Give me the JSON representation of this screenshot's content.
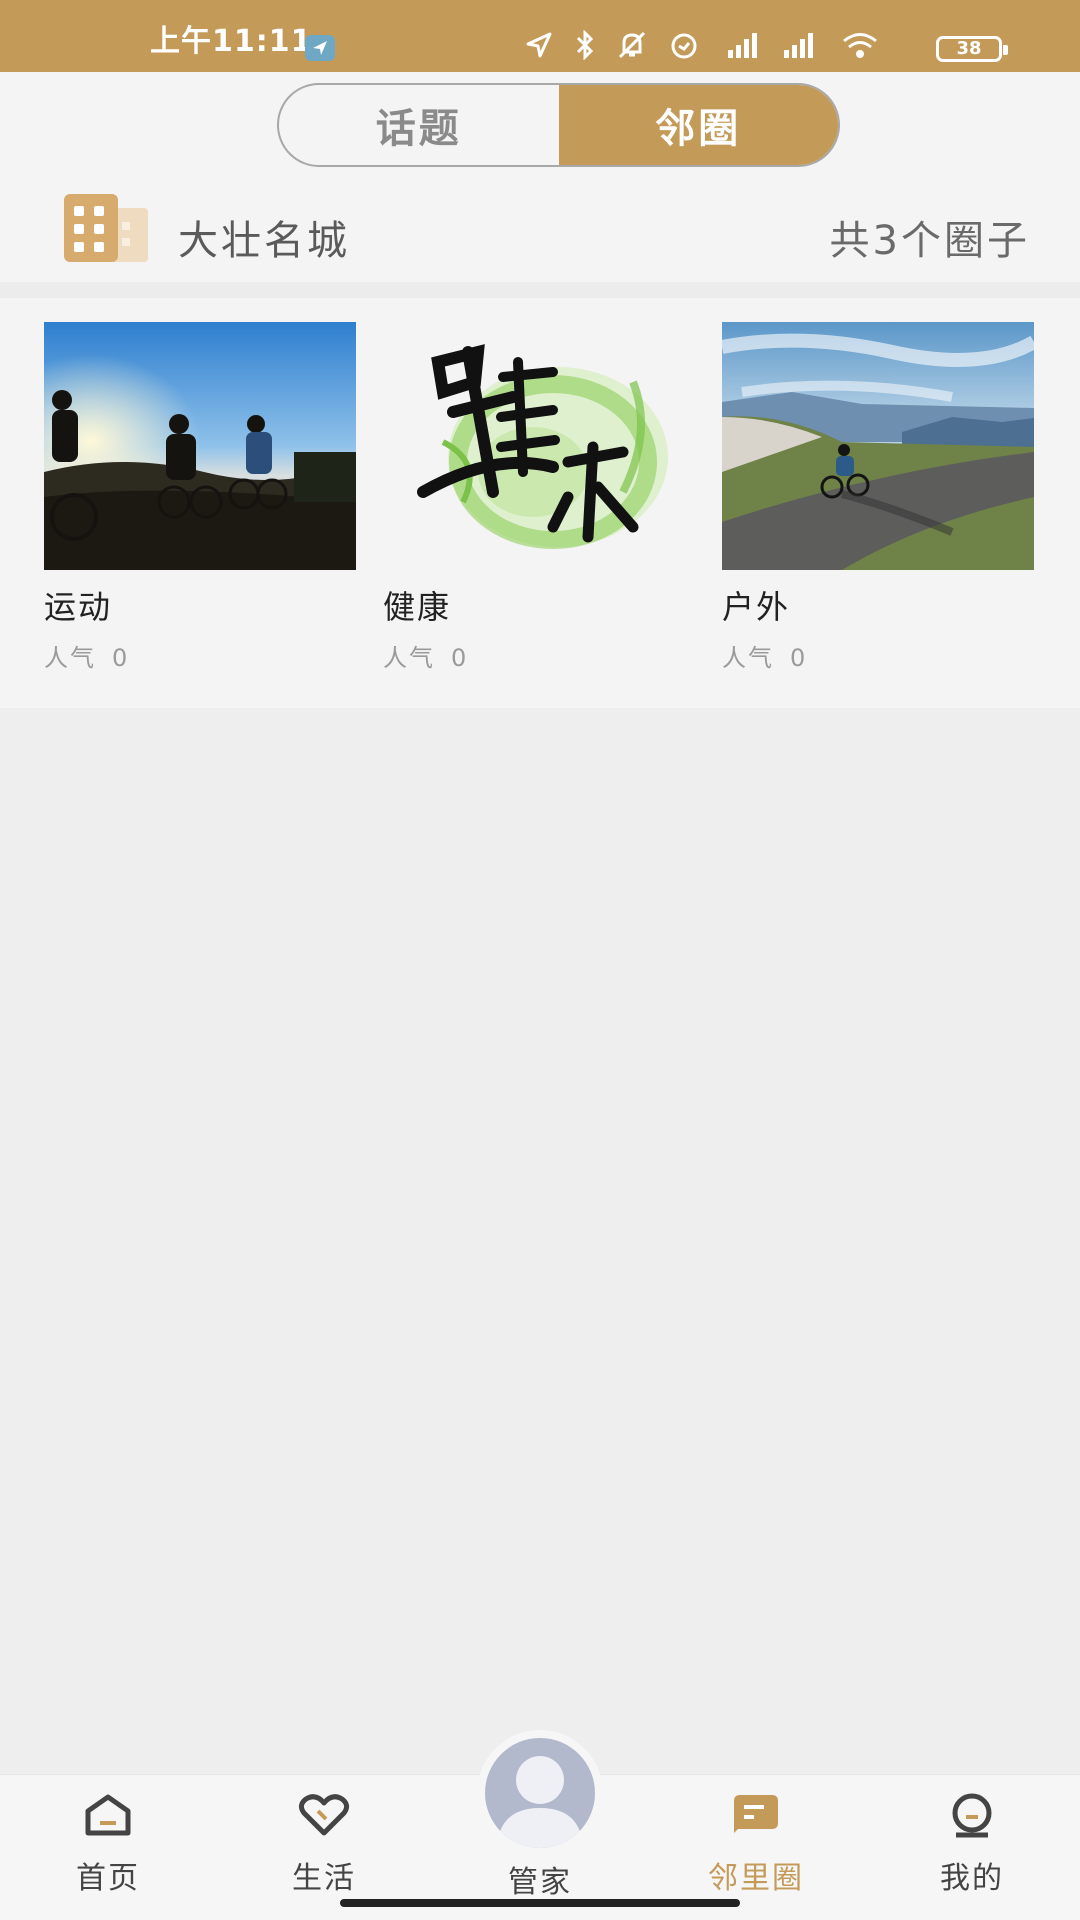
{
  "status_bar": {
    "time": "上午11:11",
    "battery": "38",
    "icons": [
      "navigation-badge-icon",
      "location-arrow-icon",
      "bluetooth-icon",
      "mute-bell-icon",
      "alarm-icon",
      "hd-signal-icon",
      "signal-icon",
      "wifi-icon",
      "battery-icon"
    ],
    "color": "#c49a58"
  },
  "segment_tabs": [
    {
      "label": "话题",
      "active": false
    },
    {
      "label": "邻圈",
      "active": true
    }
  ],
  "community": {
    "name": "大壮名城",
    "count_text": "共3个圈子",
    "icon": "building-icon"
  },
  "circles": [
    {
      "title": "运动",
      "popularity_label": "人气",
      "popularity_value": "0",
      "image": "mountain-bikers-sunset-image"
    },
    {
      "title": "健康",
      "popularity_label": "人气",
      "popularity_value": "0",
      "image": "health-calligraphy-image"
    },
    {
      "title": "户外",
      "popularity_label": "人气",
      "popularity_value": "0",
      "image": "cyclist-road-mountains-image"
    }
  ],
  "bottom_nav": [
    {
      "label": "首页",
      "icon": "home-icon",
      "active": false
    },
    {
      "label": "生活",
      "icon": "heart-icon",
      "active": false
    },
    {
      "label": "管家",
      "icon": "avatar-icon",
      "active": false
    },
    {
      "label": "邻里圈",
      "icon": "chat-bubble-icon",
      "active": true
    },
    {
      "label": "我的",
      "icon": "profile-icon",
      "active": false
    }
  ],
  "accent_color": "#c49a58"
}
